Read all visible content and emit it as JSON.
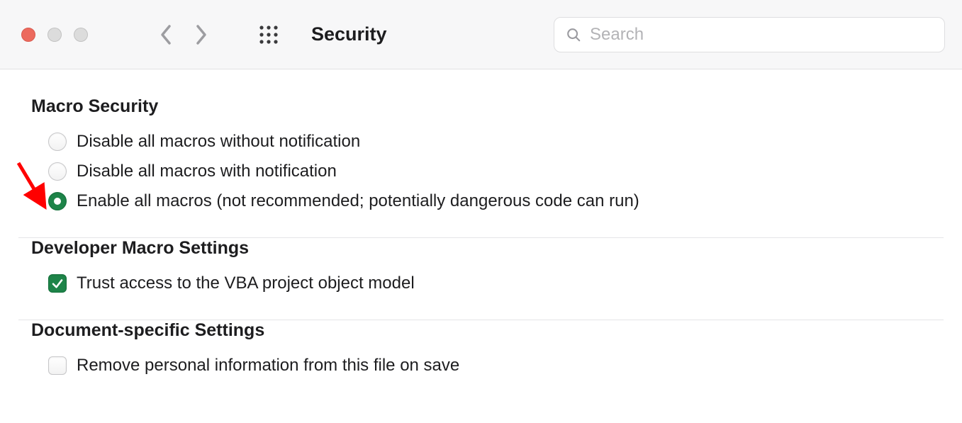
{
  "toolbar": {
    "title": "Security",
    "search_placeholder": "Search"
  },
  "sections": {
    "macro_security": {
      "heading": "Macro Security",
      "options": [
        {
          "label": "Disable all macros without notification",
          "selected": false
        },
        {
          "label": "Disable all macros with notification",
          "selected": false
        },
        {
          "label": "Enable all macros (not recommended; potentially dangerous code can run)",
          "selected": true
        }
      ]
    },
    "developer": {
      "heading": "Developer Macro Settings",
      "options": [
        {
          "label": "Trust access to the VBA project object model",
          "checked": true
        }
      ]
    },
    "document": {
      "heading": "Document-specific Settings",
      "options": [
        {
          "label": "Remove personal information from this file on save",
          "checked": false
        }
      ]
    }
  },
  "colors": {
    "accent_green": "#1e8449",
    "annotation_red": "#ff0000"
  }
}
